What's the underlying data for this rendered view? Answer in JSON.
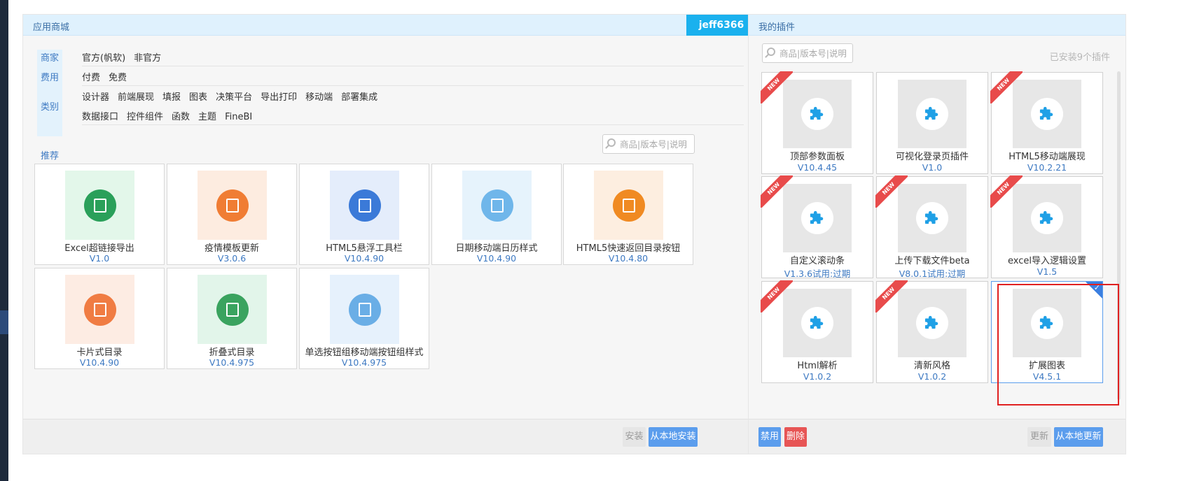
{
  "store": {
    "title": "应用商城",
    "user": "jeff6366",
    "filters": {
      "vendor_label": "商家",
      "vendor_options": [
        "官方(帆软)",
        "非官方"
      ],
      "fee_label": "费用",
      "fee_options": [
        "付费",
        "免费"
      ],
      "category_label": "类别",
      "category_options_row1": [
        "设计器",
        "前端展现",
        "填报",
        "图表",
        "决策平台",
        "导出打印",
        "移动端",
        "部署集成"
      ],
      "category_options_row2": [
        "数据接口",
        "控件组件",
        "函数",
        "主题",
        "FineBI"
      ]
    },
    "recommend_label": "推荐",
    "search_placeholder": "商品|版本号|说明",
    "items": [
      {
        "name": "Excel超链接导出",
        "version": "V1.0",
        "icon": "excel-link-icon",
        "bg": "#e3f7ea",
        "fg": "#2aa05a"
      },
      {
        "name": "疫情模板更新",
        "version": "V3.0.6",
        "icon": "shield-plus-icon",
        "bg": "#fdece0",
        "fg": "#f07d34"
      },
      {
        "name": "HTML5悬浮工具栏",
        "version": "V10.4.90",
        "icon": "mobile-toolbar-icon",
        "bg": "#e4edfb",
        "fg": "#3b7ad8"
      },
      {
        "name": "日期移动端日历样式",
        "version": "V10.4.90",
        "icon": "mobile-calendar-icon",
        "bg": "#e6f3fc",
        "fg": "#6fb6ea"
      },
      {
        "name": "HTML5快速返回目录按钮",
        "version": "V10.4.80",
        "icon": "grid-return-icon",
        "bg": "#fdeee0",
        "fg": "#f08a22"
      },
      {
        "name": "卡片式目录",
        "version": "V10.4.90",
        "icon": "card-catalog-icon",
        "bg": "#fdece3",
        "fg": "#f07c43"
      },
      {
        "name": "折叠式目录",
        "version": "V10.4.975",
        "icon": "fold-catalog-icon",
        "bg": "#e2f5ea",
        "fg": "#3aa35f"
      },
      {
        "name": "单选按钮组移动端按钮组样式",
        "version": "V10.4.975",
        "icon": "mobile-radio-icon",
        "bg": "#e6f1fc",
        "fg": "#6aaee6"
      }
    ],
    "install_label": "安装",
    "local_install_label": "从本地安装"
  },
  "mine": {
    "title": "我的插件",
    "search_placeholder": "商品|版本号|说明",
    "installed_count": "已安装9个插件",
    "new_badge": "NEW",
    "plugins": [
      {
        "name": "顶部参数面板",
        "version": "V10.4.45",
        "new": true,
        "selected": false
      },
      {
        "name": "可视化登录页插件",
        "version": "V1.0",
        "new": false,
        "selected": false
      },
      {
        "name": "HTML5移动端展现",
        "version": "V10.2.21",
        "new": true,
        "selected": false
      },
      {
        "name": "自定义滚动条",
        "version": "V1.3.6试用:过期",
        "new": true,
        "selected": false
      },
      {
        "name": "上传下载文件beta",
        "version": "V8.0.1试用:过期",
        "new": true,
        "selected": false
      },
      {
        "name": "excel导入逻辑设置",
        "version": "V1.5",
        "new": true,
        "selected": false
      },
      {
        "name": "Html解析",
        "version": "V1.0.2",
        "new": true,
        "selected": false
      },
      {
        "name": "清新风格",
        "version": "V1.0.2",
        "new": true,
        "selected": false
      },
      {
        "name": "扩展图表",
        "version": "V4.5.1",
        "new": false,
        "selected": true
      }
    ],
    "disable_label": "禁用",
    "delete_label": "删除",
    "update_label": "更新",
    "local_update_label": "从本地更新",
    "puzzle_color": "#1fa0e6"
  }
}
